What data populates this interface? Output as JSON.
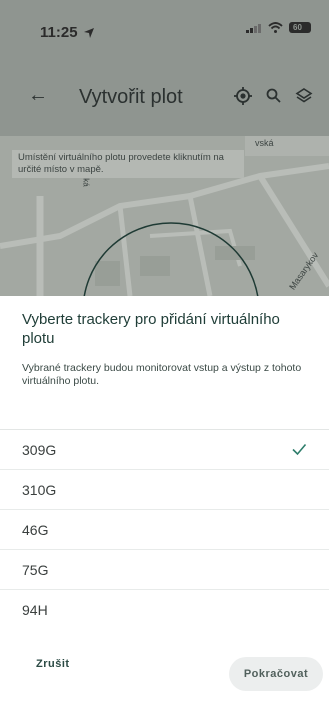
{
  "status_bar": {
    "time": "11:25",
    "battery": "60"
  },
  "app_bar": {
    "title": "Vytvořit plot"
  },
  "map": {
    "hint": "Umístění virtuálního plotu provedete kliknutím na určité místo v mapě.",
    "street_labels": [
      "vská",
      "ská",
      "Masarykov"
    ]
  },
  "sheet": {
    "title": "Vyberte trackery pro přidání virtuálního plotu",
    "description": "Vybrané trackery budou monitorovat vstup a výstup z tohoto virtuálního plotu.",
    "trackers": [
      {
        "name": "309G",
        "selected": true
      },
      {
        "name": "310G",
        "selected": false
      },
      {
        "name": "46G",
        "selected": false
      },
      {
        "name": "75G",
        "selected": false
      },
      {
        "name": "94H",
        "selected": false
      }
    ],
    "cancel_label": "Zrušit",
    "continue_label": "Pokračovat"
  },
  "colors": {
    "accent": "#2e7d6b",
    "overlay": "#8f9590"
  }
}
